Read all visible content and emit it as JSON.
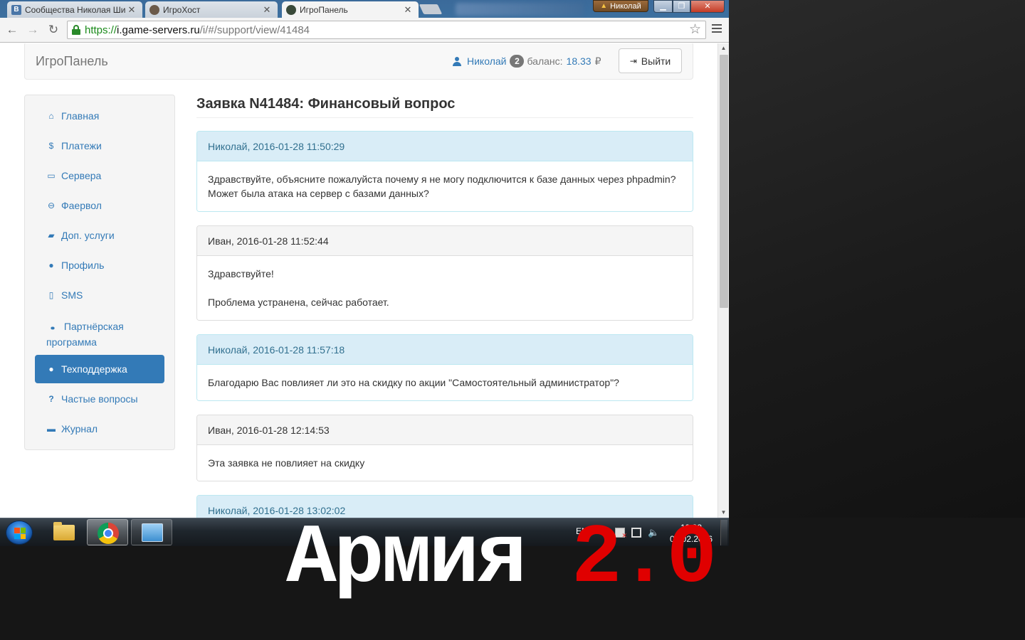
{
  "browser": {
    "tabs": [
      {
        "label": "Сообщества Николая Ши",
        "icon": "vk-icon"
      },
      {
        "label": "ИгроХост",
        "icon": "person-icon"
      },
      {
        "label": "ИгроПанель",
        "icon": "gamepad-icon"
      }
    ],
    "profile_name": "Николай",
    "url": {
      "scheme": "https://",
      "host": "i.game-servers.ru",
      "path": "/i/#/support/view/41484"
    }
  },
  "header": {
    "brand": "ИгроПанель",
    "user": "Николай",
    "badge": "2",
    "balance_label": "баланс:",
    "balance_value": "18.33",
    "currency": "₽",
    "logout_label": "Выйти"
  },
  "sidebar": {
    "items": [
      {
        "label": "Главная",
        "icon": "home-icon",
        "glyph": "⌂"
      },
      {
        "label": "Платежи",
        "icon": "dollar-icon",
        "glyph": "$"
      },
      {
        "label": "Сервера",
        "icon": "hdd-icon",
        "glyph": "▭"
      },
      {
        "label": "Фаервол",
        "icon": "minus-circle-icon",
        "glyph": "⊖"
      },
      {
        "label": "Доп. услуги",
        "icon": "folder-open-icon",
        "glyph": "▰"
      },
      {
        "label": "Профиль",
        "icon": "user-icon",
        "glyph": "●"
      },
      {
        "label": "SMS",
        "icon": "phone-icon",
        "glyph": "▯"
      },
      {
        "label": "Партнёрская программа",
        "icon": "users-icon",
        "glyph": "●●"
      },
      {
        "label": "Техподдержка",
        "icon": "comments-icon",
        "glyph": "●",
        "active": true
      },
      {
        "label": "Частые вопросы",
        "icon": "question-icon",
        "glyph": "?"
      },
      {
        "label": "Журнал",
        "icon": "archive-icon",
        "glyph": "▬"
      }
    ]
  },
  "ticket": {
    "title": "Заявка N41484: Финансовый вопрос",
    "messages": [
      {
        "header": "Николай, 2016-01-28 11:50:29",
        "lines": [
          "Здравствуйте, объясните пожалуйста почему я не могу подключится к базе данных через phpadmin? Может была атака на сервер с базами данных?"
        ]
      },
      {
        "header": "Иван, 2016-01-28 11:52:44",
        "lines": [
          "Здравствуйте!",
          "Проблема устранена, сейчас работает."
        ]
      },
      {
        "header": "Николай, 2016-01-28 11:57:18",
        "lines": [
          "Благодарю Вас повлияет ли это на скидку по акции \"Самостоятельный администратор\"?"
        ]
      },
      {
        "header": "Иван, 2016-01-28 12:14:53",
        "lines": [
          "Эта заявка не повлияет на скидку"
        ]
      },
      {
        "header": "Николай, 2016-01-28 13:02:02",
        "lines": []
      }
    ]
  },
  "taskbar": {
    "lang": "EN",
    "time": "19:32",
    "date": "01.02.2016"
  },
  "caption": {
    "part1": "Армия ",
    "part2": "2.0"
  },
  "colors": {
    "accent": "#337ab7",
    "info_bg": "#d9edf7",
    "caption_red": "#e00000"
  }
}
